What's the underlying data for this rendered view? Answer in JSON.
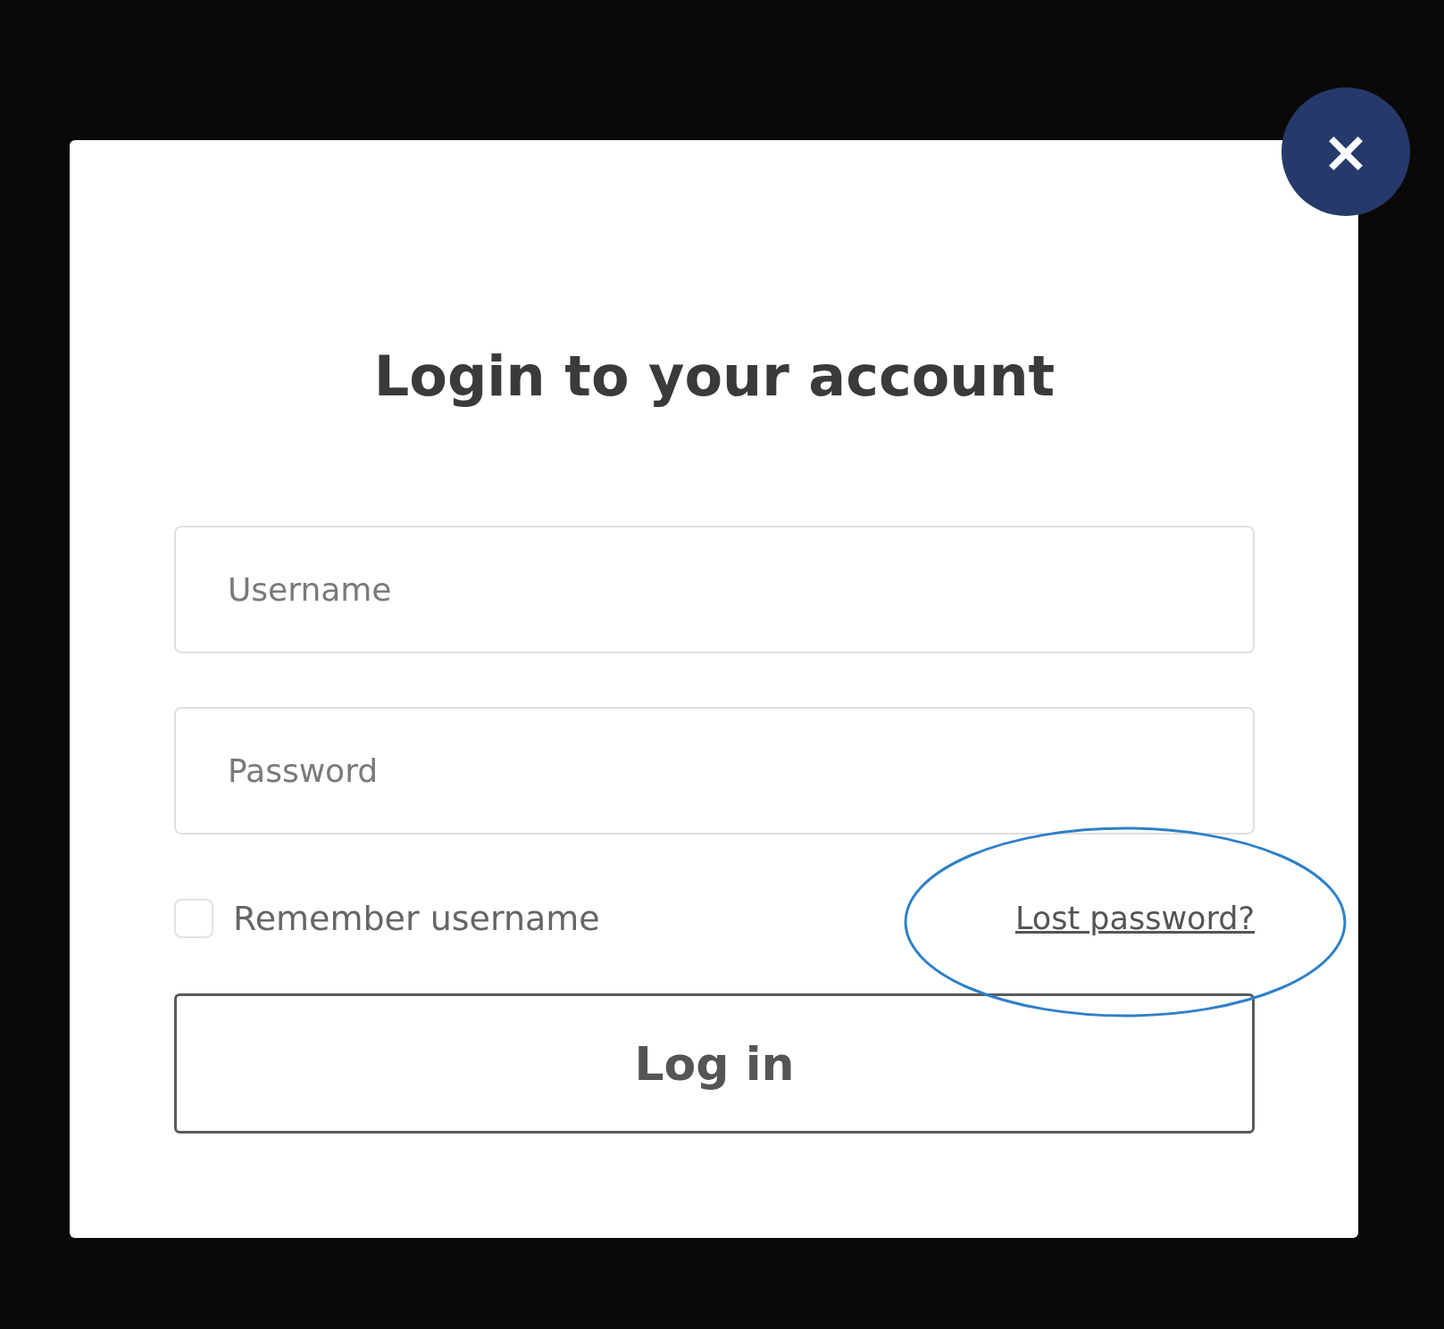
{
  "dialog": {
    "title": "Login to your account",
    "close": "×"
  },
  "fields": [
    {
      "placeholder": "Username"
    },
    {
      "placeholder": "Password"
    }
  ],
  "remember": {
    "label": "Remember username",
    "checked": false
  },
  "lost_password": "Lost password?",
  "submit": "Log in"
}
